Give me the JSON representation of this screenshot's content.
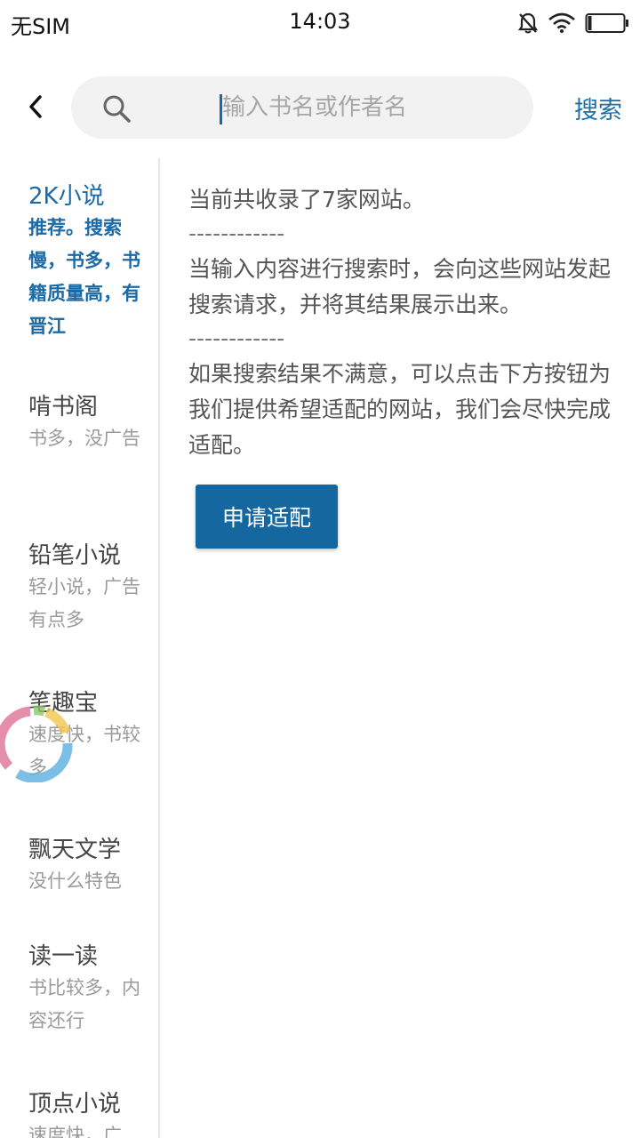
{
  "status_bar": {
    "carrier": "无SIM",
    "time": "14:03"
  },
  "header": {
    "search_placeholder": "输入书名或作者名",
    "search_value": "",
    "search_button": "搜索"
  },
  "sidebar": {
    "items": [
      {
        "name": "2K小说",
        "desc": "推荐。搜索慢，书多，书籍质量高，有晋江",
        "active": true
      },
      {
        "name": "啃书阁",
        "desc": "书多，没广告",
        "active": false
      },
      {
        "name": "铅笔小说",
        "desc": "轻小说，广告有点多",
        "active": false
      },
      {
        "name": "笔趣宝",
        "desc": "速度快，书较多",
        "active": false
      },
      {
        "name": "飘天文学",
        "desc": "没什么特色",
        "active": false
      },
      {
        "name": "读一读",
        "desc": "书比较多，内容还行",
        "active": false
      },
      {
        "name": "顶点小说",
        "desc": "速度快，广",
        "active": false
      }
    ]
  },
  "content": {
    "line1": "当前共收录了7家网站。",
    "divider": "------------",
    "line2": "当输入内容进行搜索时，会向这些网站发起搜索请求，并将其结果展示出来。",
    "line3": "如果搜索结果不满意，可以点击下方按钮为我们提供希望适配的网站，我们会尽快完成适配。",
    "apply_button": "申请适配"
  },
  "colors": {
    "accent": "#1a6aa8",
    "button_bg": "#14679f"
  }
}
